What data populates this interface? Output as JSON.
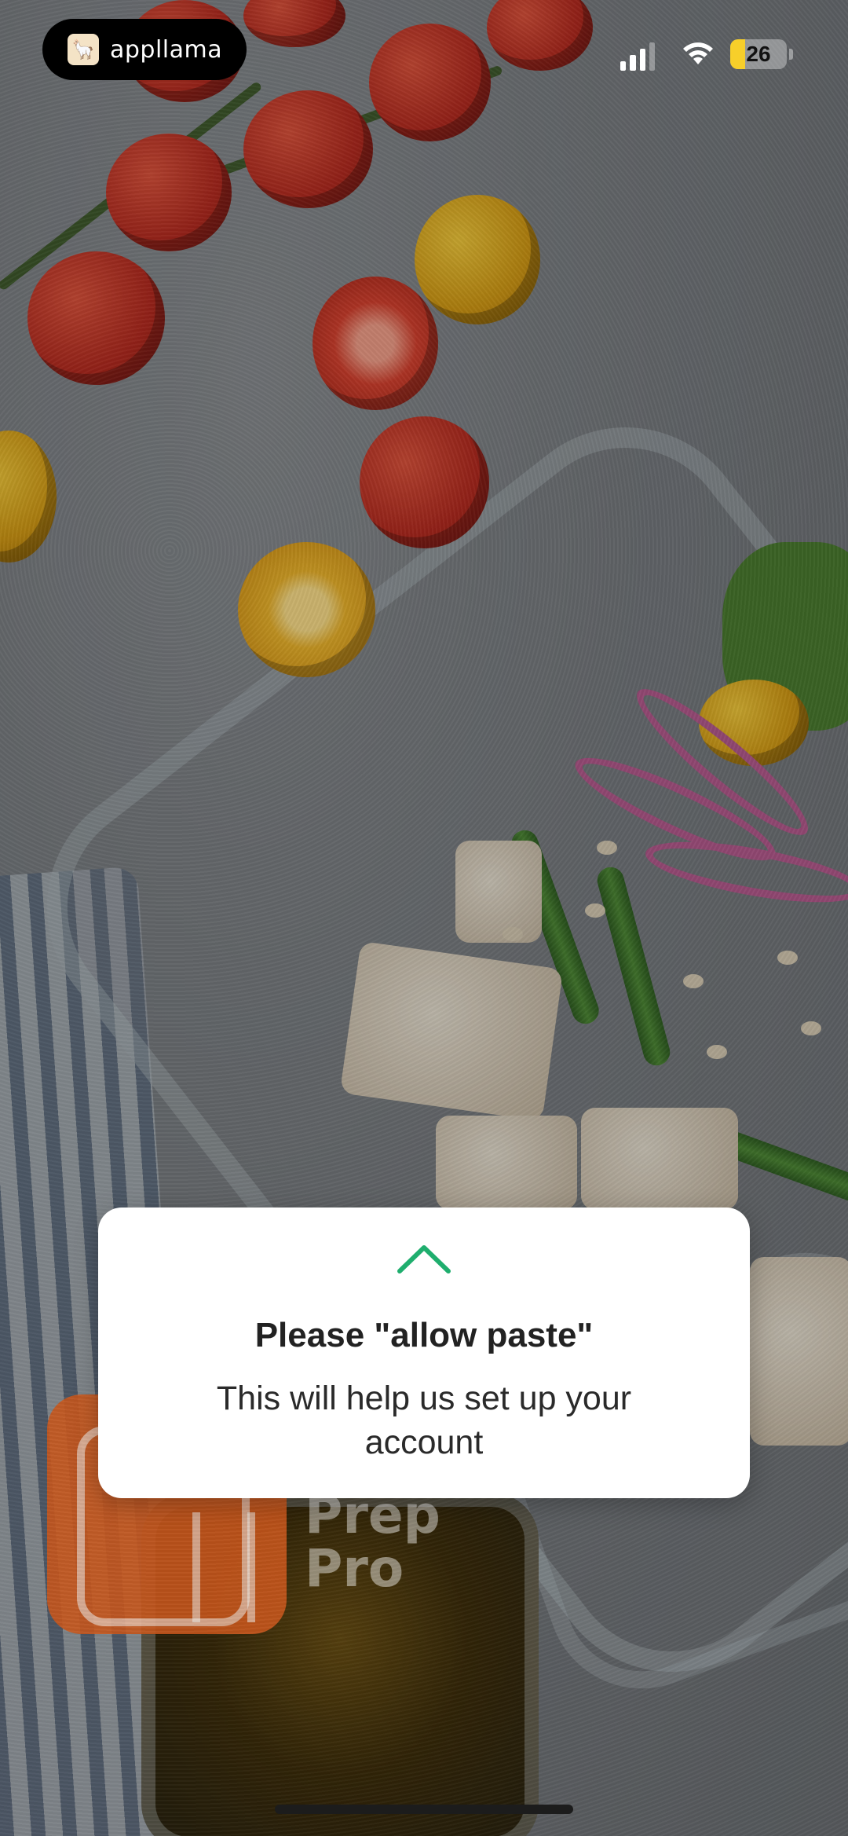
{
  "status_bar": {
    "brand": "appllama",
    "battery": "26",
    "battery_level_percent": 26,
    "signal_bars": 3,
    "icons": [
      "llama-logo-icon",
      "signal-icon",
      "wifi-icon",
      "battery-icon"
    ]
  },
  "background": {
    "app_name_line1": "Prep",
    "app_name_line2": "Pro",
    "accent_color": "#c8571c"
  },
  "modal": {
    "title": "Please \"allow paste\"",
    "body": "This will help us set up your account",
    "chevron_color": "#1fae6e"
  }
}
